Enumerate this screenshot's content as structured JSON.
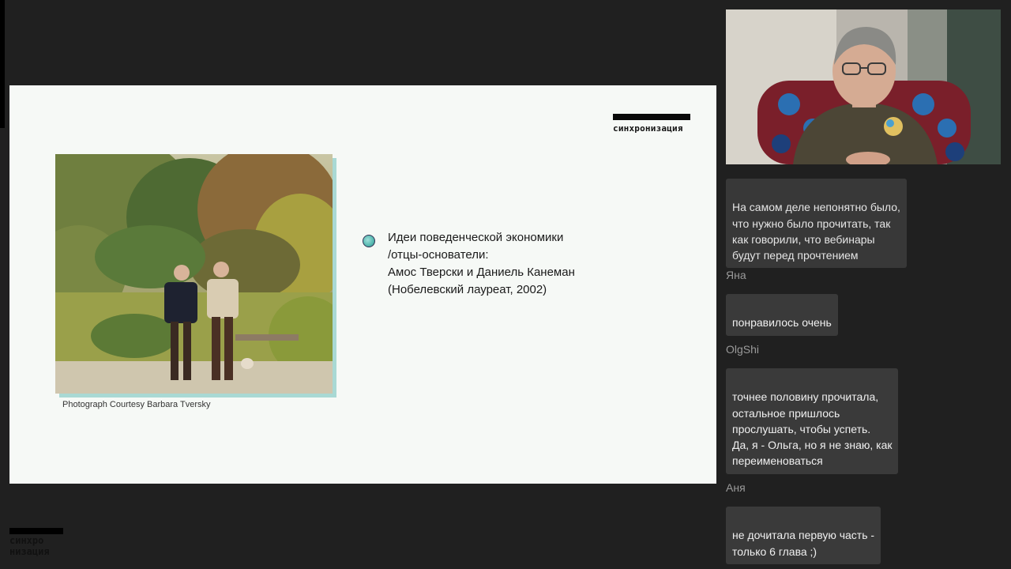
{
  "slide": {
    "brand": "синхронизация",
    "photo_caption": "Photograph Courtesy Barbara Tversky",
    "bullet_text": "Идеи поведенческой экономики\n/отцы-основатели:\nАмос Тверски и Даниель Канеман\n(Нобелевский лауреат, 2002)"
  },
  "chat": {
    "messages": [
      {
        "author": "",
        "text": "На самом деле непонятно было,\nчто нужно было прочитать, так\nкак говорили, что вебинары\nбудут перед прочтением"
      },
      {
        "author": "Яна",
        "text": "понравилось очень"
      },
      {
        "author": "OlgShi",
        "text": "точнее половину прочитала,\nостальное пришлось\nпрослушать, чтобы успеть.\nДа, я - Ольга, но я не знаю, как\nпереименоваться"
      },
      {
        "author": "Аня",
        "text": "не дочитала первую часть -\nтолько 6 глава ;)"
      }
    ]
  },
  "footer_logo": {
    "line1": "синхро",
    "line2": "низация"
  },
  "colors": {
    "background": "#202020",
    "slide_bg": "#f6f9f6",
    "bubble": "#3a3a3a",
    "accent_teal": "#a9d9d4"
  }
}
